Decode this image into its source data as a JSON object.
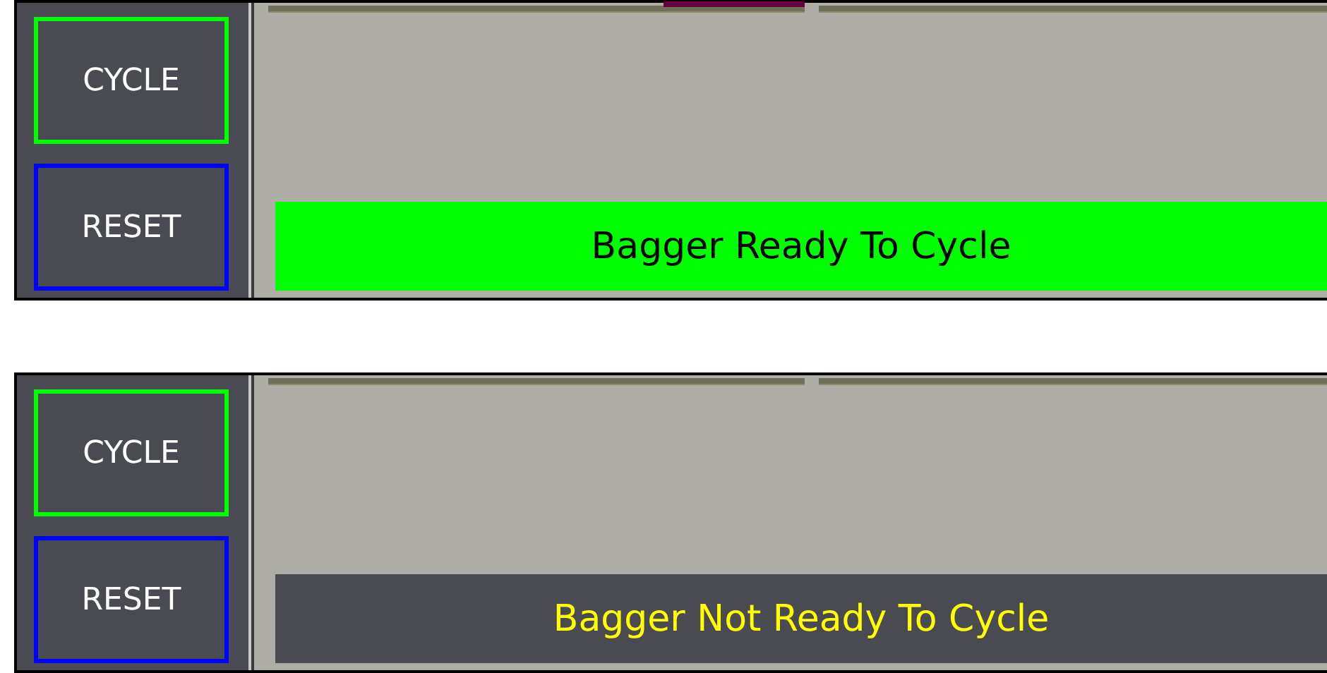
{
  "panels": [
    {
      "indicator_on": true,
      "buttons": [
        {
          "label": "CYCLE",
          "color": "#00ff00"
        },
        {
          "label": "RESET",
          "color": "#0000ff"
        }
      ],
      "status": {
        "kind": "ready",
        "text": "Bagger Ready To Cycle"
      }
    },
    {
      "indicator_on": false,
      "buttons": [
        {
          "label": "CYCLE",
          "color": "#00ff00"
        },
        {
          "label": "RESET",
          "color": "#0000ff"
        }
      ],
      "status": {
        "kind": "not_ready",
        "text": "Bagger Not Ready To Cycle"
      }
    }
  ]
}
